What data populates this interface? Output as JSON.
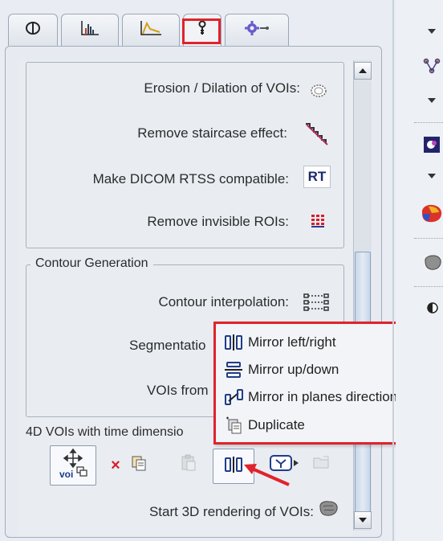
{
  "tabs": [
    {
      "name": "tab-voi-definition",
      "icon": "circle-roi-icon"
    },
    {
      "name": "tab-statistics",
      "icon": "histogram-icon"
    },
    {
      "name": "tab-tac",
      "icon": "curve-icon"
    },
    {
      "name": "tab-tools",
      "icon": "tools-icon",
      "selected": true
    },
    {
      "name": "tab-settings",
      "icon": "gear-icon"
    }
  ],
  "tools": {
    "erosion_label": "Erosion / Dilation of VOIs:",
    "staircase_label": "Remove staircase effect:",
    "rtss_label": "Make DICOM RTSS compatible:",
    "rtss_icon_text": "RT",
    "invisible_label": "Remove invisible ROIs:"
  },
  "contour": {
    "title": "Contour Generation",
    "interp_label": "Contour interpolation:",
    "segmentation_label": "Segmentatio",
    "vois_from_label": "VOIs from"
  },
  "time_dim_label": "4D VOIs with time dimensio",
  "render_label": "Start 3D rendering of VOIs:",
  "toolbar": {
    "voi_icon_text": "voi"
  },
  "menu": {
    "items": [
      {
        "label": "Mirror left/right",
        "icon": "mirror-left-right-icon"
      },
      {
        "label": "Mirror up/down",
        "icon": "mirror-up-down-icon"
      },
      {
        "label": "Mirror in planes direction",
        "icon": "mirror-planes-icon"
      },
      {
        "label": "Duplicate",
        "icon": "duplicate-icon"
      }
    ]
  },
  "colors": {
    "accent_red": "#e0232c",
    "panel": "#e9edf2"
  }
}
